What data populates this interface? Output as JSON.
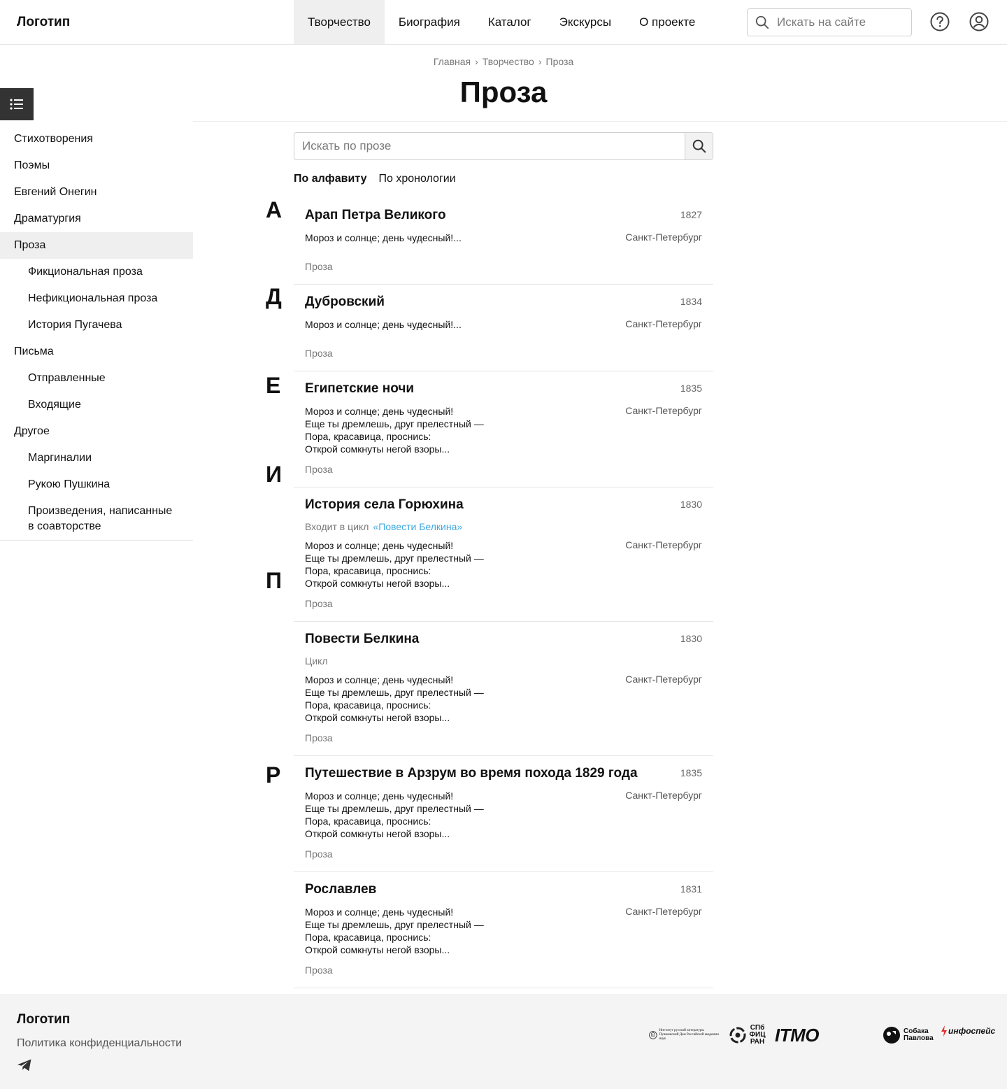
{
  "header": {
    "logo": "Логотип",
    "nav": [
      "Творчество",
      "Биография",
      "Каталог",
      "Экскурсы",
      "О проекте"
    ],
    "search_placeholder": "Искать на сайте"
  },
  "breadcrumb": [
    "Главная",
    "Творчество",
    "Проза"
  ],
  "page_title": "Проза",
  "sidebar": {
    "items": [
      {
        "label": "Стихотворения"
      },
      {
        "label": "Поэмы"
      },
      {
        "label": "Евгений Онегин"
      },
      {
        "label": "Драматургия"
      },
      {
        "label": "Проза"
      },
      {
        "label": "Фикциональная проза"
      },
      {
        "label": "Нефикциональная проза"
      },
      {
        "label": "История Пугачева"
      },
      {
        "label": "Письма"
      },
      {
        "label": "Отправленные"
      },
      {
        "label": "Входящие"
      },
      {
        "label": "Другое"
      },
      {
        "label": "Маргиналии"
      },
      {
        "label": "Рукою Пушкина"
      },
      {
        "label": "Произведения, написанные в соавторстве"
      }
    ]
  },
  "prose_search": {
    "placeholder": "Искать по прозе"
  },
  "sort_tabs": [
    "По алфавиту",
    "По хронологии"
  ],
  "letters": [
    "А",
    "Д",
    "Е",
    "И",
    "П",
    "Р"
  ],
  "entries": [
    {
      "title": "Арап Петра Великого",
      "year": "1827",
      "place": "Санкт-Петербург",
      "excerpt": "Мороз и солнце; день чудесный!...",
      "genre": "Проза"
    },
    {
      "title": "Дубровский",
      "year": "1834",
      "place": "Санкт-Петербург",
      "excerpt": "Мороз и солнце; день чудесный!...",
      "genre": "Проза"
    },
    {
      "title": "Египетские ночи",
      "year": "1835",
      "place": "Санкт-Петербург",
      "excerpt": "Мороз и солнце; день чудесный!\nЕще ты дремлешь, друг прелестный —\nПора, красавица, проснись:\nОткрой сомкнуты негой взоры...",
      "genre": "Проза"
    },
    {
      "title": "История села Горюхина",
      "year": "1830",
      "cycle_prefix": "Входит в цикл",
      "cycle_link": "«Повести Белкина»",
      "place": "Санкт-Петербург",
      "excerpt": "Мороз и солнце; день чудесный!\nЕще ты дремлешь, друг прелестный —\nПора, красавица, проснись:\nОткрой сомкнуты негой взоры...",
      "genre": "Проза"
    },
    {
      "title": "Повести Белкина",
      "year": "1830",
      "cycle_prefix": "Цикл",
      "place": "Санкт-Петербург",
      "excerpt": "Мороз и солнце; день чудесный!\nЕще ты дремлешь, друг прелестный —\nПора, красавица, проснись:\nОткрой сомкнуты негой взоры...",
      "genre": "Проза"
    },
    {
      "title": "Путешествие в Арзрум во время похода 1829 года",
      "year": "1835",
      "place": "Санкт-Петербург",
      "excerpt": "Мороз и солнце; день чудесный!\nЕще ты дремлешь, друг прелестный —\nПора, красавица, проснись:\nОткрой сомкнуты негой взоры...",
      "genre": "Проза"
    },
    {
      "title": "Рославлев",
      "year": "1831",
      "place": "Санкт-Петербург",
      "excerpt": "Мороз и солнце; день чудесный!\nЕще ты дремлешь, друг прелестный —\nПора, красавица, проснись:\nОткрой сомкнуты негой взоры...",
      "genre": "Проза"
    }
  ],
  "footer": {
    "logo": "Логотип",
    "privacy": "Политика конфиденциальности",
    "partners": {
      "pushkin_house": "Институт русской литературы Пушкинский Дом Российской академии наук",
      "spb": "СПб ФИЦ РАН",
      "itmo": "ITMO",
      "sobaka": "Собака Павлова",
      "infospace": "инфоспейс"
    }
  }
}
